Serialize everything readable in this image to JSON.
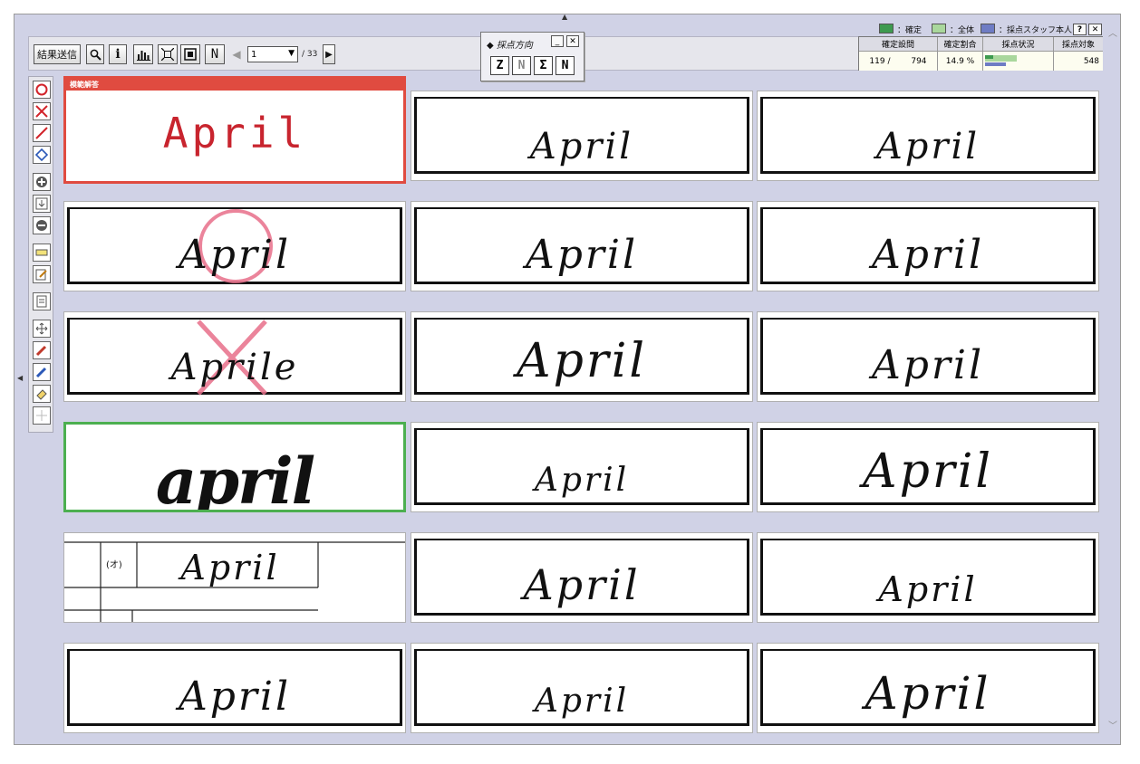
{
  "toolbar": {
    "send_label": "結果送信",
    "page_value": "1",
    "page_total": "/ 33"
  },
  "direction_panel": {
    "title": "◆ 採点方向",
    "min_label": "_",
    "close_label": "✕",
    "directions": [
      "Z",
      "N",
      "Σ",
      "N"
    ]
  },
  "legend": {
    "confirmed": "：確定",
    "total": "：全体",
    "staff": "：採点スタッフ本人",
    "colors": {
      "confirmed": "#3e9a4f",
      "total": "#a9d79c",
      "staff": "#6e7cc4"
    }
  },
  "window_buttons": {
    "help": "?",
    "close": "✕"
  },
  "stats": {
    "headers": [
      "確定設問",
      "確定割合",
      "採点状況",
      "採点対象"
    ],
    "confirmed_count": "119 /",
    "question_total": "794",
    "confirmed_ratio": "14.9 %",
    "progress_total_fraction": 0.48,
    "progress_staff_fraction": 0.32,
    "progress_confirmed_fraction": 0.12,
    "target_count": "548"
  },
  "palette": {
    "tools": [
      "circle-mark-icon",
      "cross-mark-icon",
      "slash-mark-icon",
      "diamond-mark-icon",
      "plus-icon",
      "insert-icon",
      "minus-icon",
      "highlight-icon",
      "memo-icon",
      "page-icon",
      "move-icon",
      "red-pen-icon",
      "blue-pen-icon",
      "eraser-icon",
      "move-disabled-icon"
    ]
  },
  "model_answer": {
    "header": "模範解答",
    "text": "April"
  },
  "answers": [
    {
      "text": "April"
    },
    {
      "text": "April"
    },
    {
      "text": "April",
      "mark": "circle"
    },
    {
      "text": "April"
    },
    {
      "text": "April"
    },
    {
      "text": "Aprile",
      "mark": "cross"
    },
    {
      "text": "April"
    },
    {
      "text": "April"
    },
    {
      "text": "april",
      "selected": true
    },
    {
      "text": "April"
    },
    {
      "text": "April"
    },
    {
      "text": "April",
      "form_label": "(オ)"
    },
    {
      "text": "April"
    },
    {
      "text": "April"
    },
    {
      "text": "April"
    },
    {
      "text": "April"
    },
    {
      "text": "April"
    }
  ]
}
